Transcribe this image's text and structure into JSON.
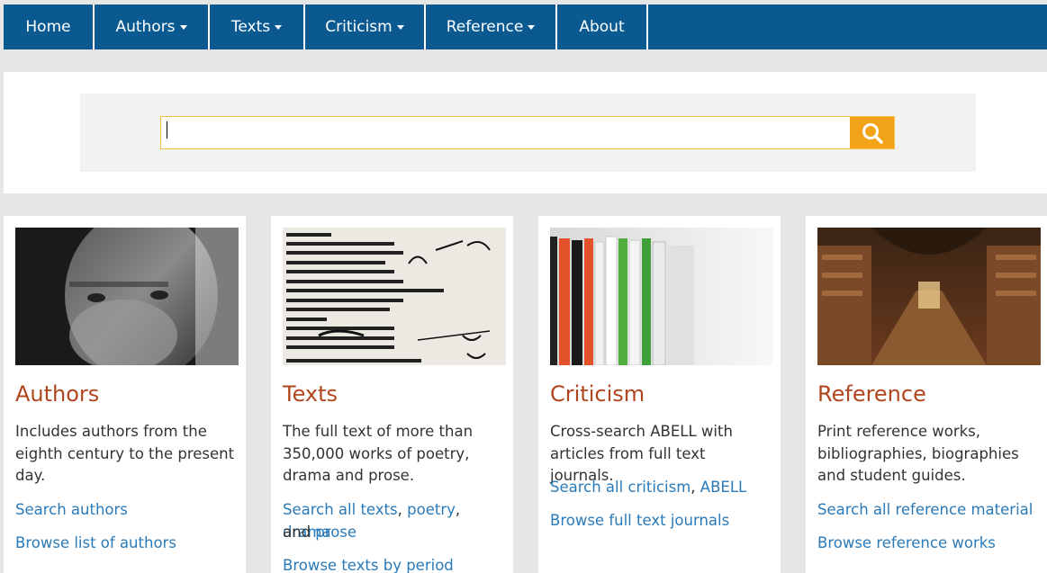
{
  "nav": {
    "items": [
      {
        "label": "Home",
        "dropdown": false
      },
      {
        "label": "Authors",
        "dropdown": true
      },
      {
        "label": "Texts",
        "dropdown": true
      },
      {
        "label": "Criticism",
        "dropdown": true
      },
      {
        "label": "Reference",
        "dropdown": true
      },
      {
        "label": "About",
        "dropdown": false
      }
    ]
  },
  "search": {
    "value": "",
    "button_icon": "search-icon"
  },
  "colors": {
    "nav_bg": "#0a5a91",
    "accent": "#f2a318",
    "title": "#b0461e",
    "link": "#2a7ab8"
  },
  "cards": [
    {
      "title": "Authors",
      "image": "author-portrait-photo",
      "description": "Includes authors from the eighth century to the present day.",
      "link1": "Search authors",
      "link2": "Browse list of authors"
    },
    {
      "title": "Texts",
      "image": "manuscript-photo",
      "description": "The full text of more than 350,000 works of poetry, drama and prose.",
      "link_all": "Search all texts",
      "link_poetry": "poetry",
      "link_drama": "drama",
      "and_text": "and",
      "link_prose": "prose",
      "link_period": "Browse texts by period"
    },
    {
      "title": "Criticism",
      "image": "journals-photo",
      "description": "Cross-search ABELL with articles from full text journals.",
      "link_all": "Search all criticism",
      "link_abell": "ABELL",
      "link2": "Browse full text journals"
    },
    {
      "title": "Reference",
      "image": "library-photo",
      "description": "Print reference works, bibliographies, biographies and student guides.",
      "link1": "Search all reference material",
      "link2": "Browse reference works"
    }
  ]
}
